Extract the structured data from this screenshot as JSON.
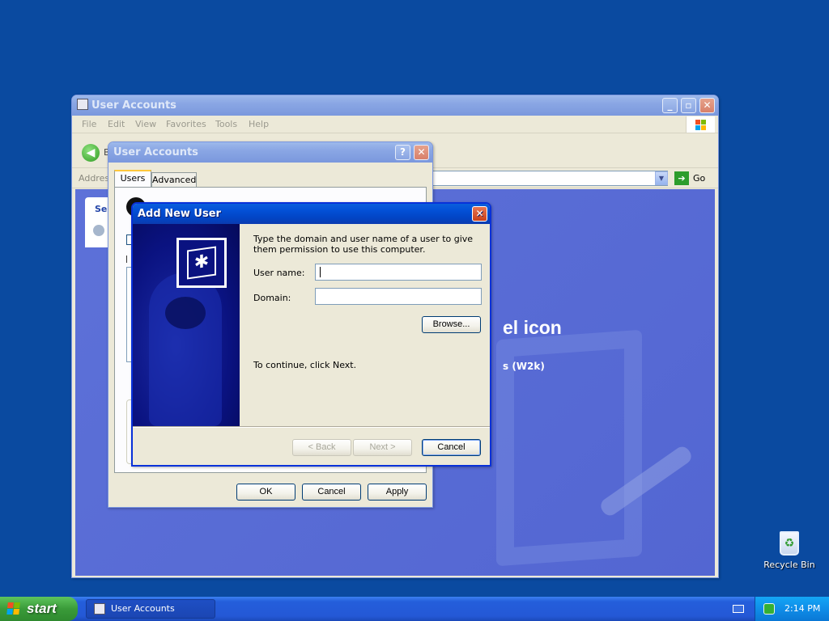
{
  "main_window": {
    "title": "User Accounts",
    "menu": [
      "File",
      "Edit",
      "View",
      "Favorites",
      "Tools",
      "Help"
    ],
    "back_label": "B",
    "address_label": "Addres",
    "go_label": "Go",
    "tab_label": "Se",
    "heading": "el icon",
    "subheading": "s (W2k)"
  },
  "ua_dialog": {
    "title": "User Accounts",
    "tabs": [
      "Users",
      "Advanced"
    ],
    "ok": "OK",
    "cancel": "Cancel",
    "apply": "Apply"
  },
  "add_user": {
    "title": "Add New User",
    "instruction": "Type the domain and user name of a user to give them permission to use this computer.",
    "username_label": "User name:",
    "username_value": "",
    "domain_label": "Domain:",
    "domain_value": "",
    "browse": "Browse...",
    "continue_text": "To continue, click Next.",
    "back": "< Back",
    "next": "Next >",
    "cancel": "Cancel"
  },
  "desktop": {
    "recycle_bin": "Recycle Bin"
  },
  "taskbar": {
    "start": "start",
    "task": "User Accounts",
    "clock": "2:14 PM"
  }
}
